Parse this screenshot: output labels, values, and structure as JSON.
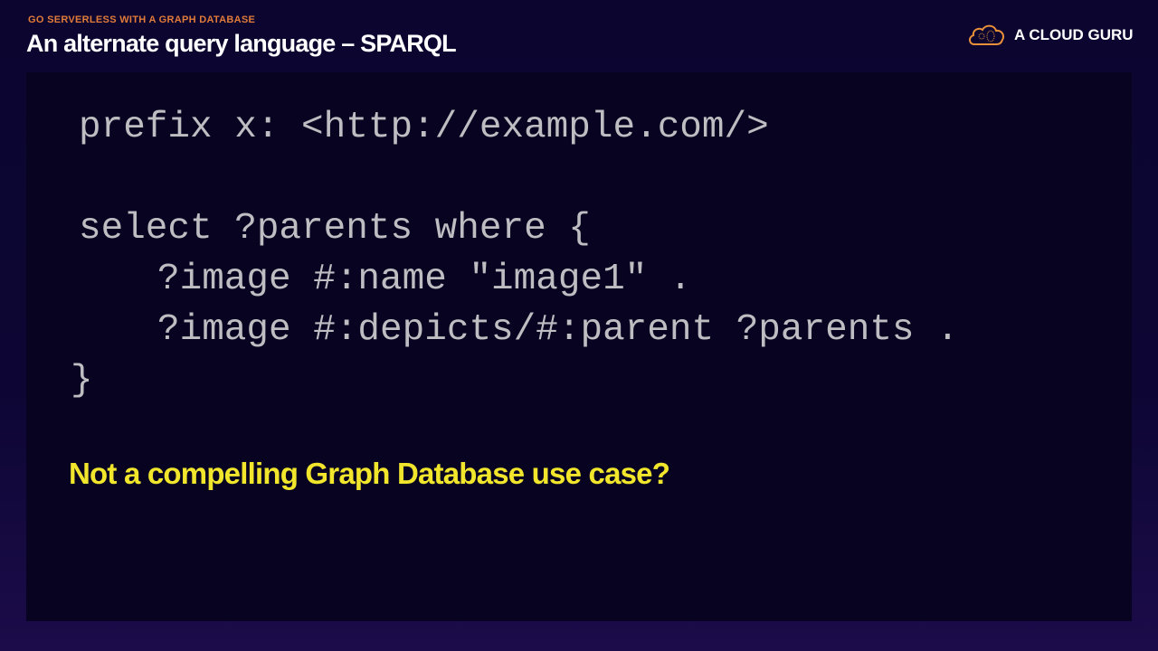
{
  "header": {
    "kicker": "GO SERVERLESS WITH A GRAPH DATABASE",
    "title": "An alternate query language – SPARQL"
  },
  "brand": {
    "name": "A CLOUD GURU",
    "icon": "cloud-logo-icon",
    "accent": "#e8913a"
  },
  "code": {
    "lines": [
      "prefix x: <http://example.com/>",
      "",
      "select ?parents where {",
      "?image #:name \"image1\" .",
      "?image #:depicts/#:parent ?parents .",
      "}"
    ]
  },
  "note": {
    "text": "Not a compelling Graph Database use case?",
    "color": "#f2e62c"
  }
}
